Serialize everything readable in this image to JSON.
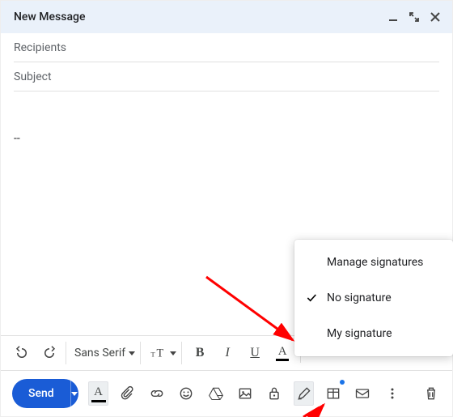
{
  "header": {
    "title": "New Message",
    "minimize_icon": "minimize-icon",
    "expand_icon": "expand-icon",
    "close_icon": "close-icon"
  },
  "fields": {
    "recipients_placeholder": "Recipients",
    "subject_placeholder": "Subject"
  },
  "body": {
    "signature_separator": "--"
  },
  "toolbar": {
    "undo": "undo",
    "redo": "redo",
    "font_family_label": "Sans Serif",
    "font_size_icon": "font-size",
    "bold": "B",
    "italic": "I",
    "underline": "U",
    "text_color": "A",
    "more_formatting": "more"
  },
  "signature_menu": {
    "manage": "Manage signatures",
    "no_signature": "No signature",
    "my_signature": "My signature",
    "selected": "no_signature"
  },
  "actions": {
    "send_label": "Send"
  }
}
